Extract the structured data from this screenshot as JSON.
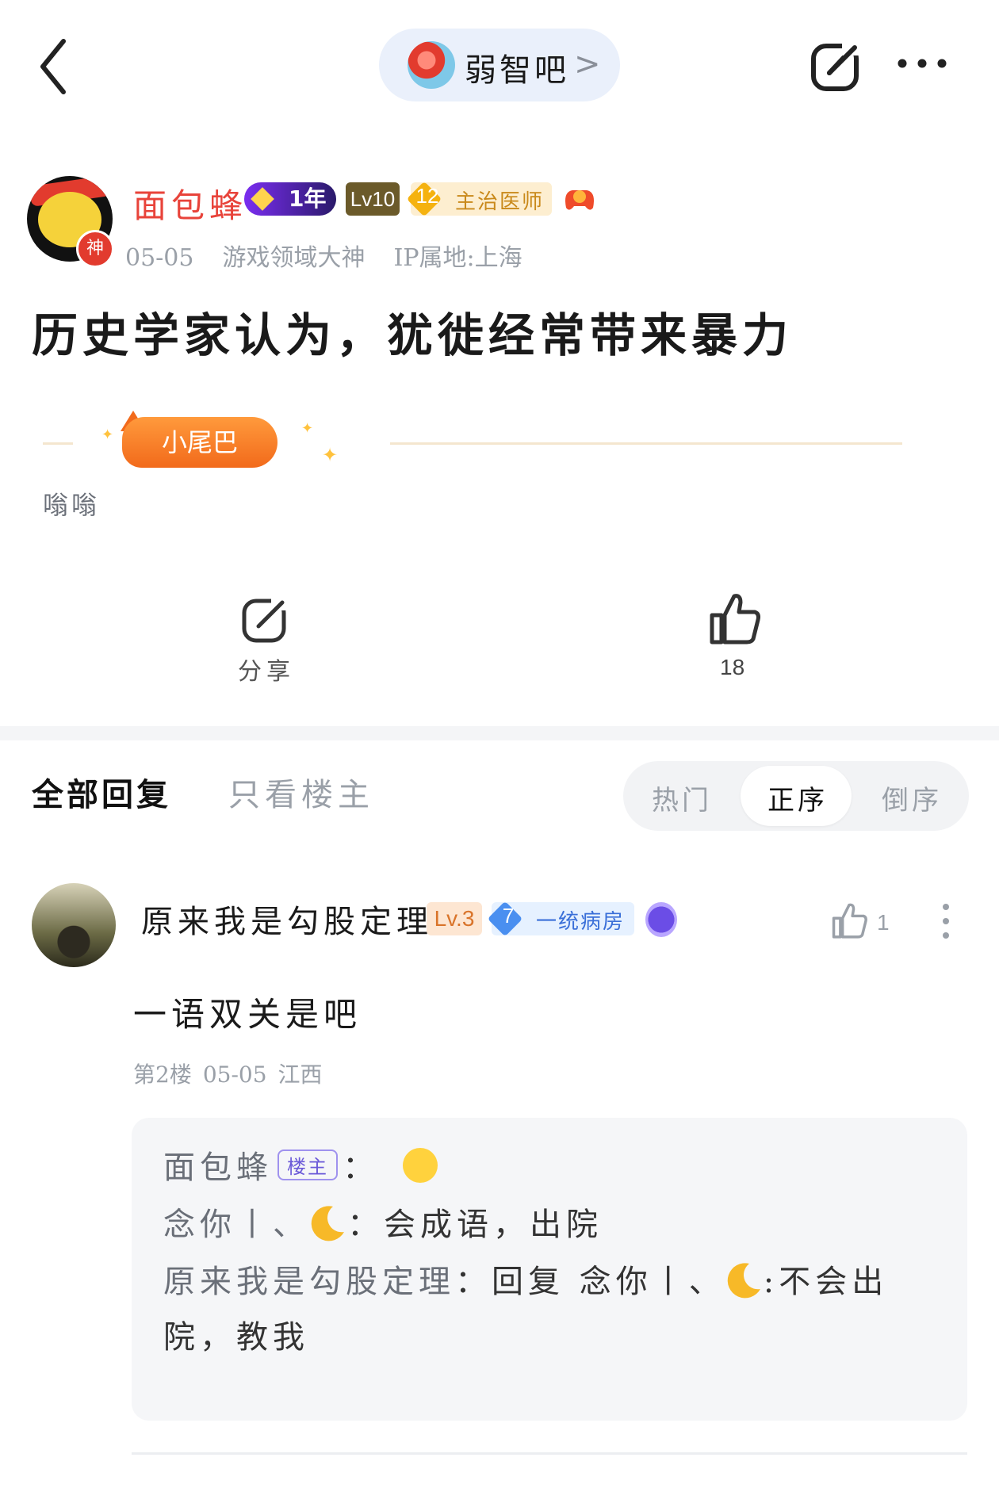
{
  "topbar": {
    "forum_name": "弱智吧",
    "forum_arrow": ">",
    "back_icon": "chevron-left-icon",
    "share_icon": "share-icon",
    "more_icon": "more-dots-icon"
  },
  "author": {
    "name": "面包蜂",
    "god_badge": "神",
    "year_badge": "1年",
    "level_badge": "Lv10",
    "doctor_level": "12",
    "doctor_title": "主治医师",
    "date": "05-05",
    "tag": "游戏领域大神",
    "ip": "IP属地:上海"
  },
  "post": {
    "title": "历史学家认为，犹徙经常带来暴力",
    "tail_label": "小尾巴",
    "signature": "嗡嗡"
  },
  "actions": {
    "share_label": "分享",
    "like_count": "18"
  },
  "tabs": {
    "all": "全部回复",
    "owner_only": "只看楼主",
    "sort_hot": "热门",
    "sort_asc": "正序",
    "sort_desc": "倒序"
  },
  "reply": {
    "name": "原来我是勾股定理",
    "level_badge": "Lv.3",
    "ward_level": "7",
    "ward_title": "一统病房",
    "like_count": "1",
    "content": "一语双关是吧",
    "floor": "第2楼",
    "date": "05-05",
    "location": "江西"
  },
  "sub_replies": {
    "line1_name": "面包蜂",
    "owner_tag": "楼主",
    "colon": "：",
    "line2_name": "念你丨、",
    "line2_text": "：会成语，出院",
    "line3_name": "原来我是勾股定理",
    "line3_text_a": "：回复 念你丨、",
    "line3_text_b": ":不会出",
    "line4_text": "院，教我"
  },
  "colors": {
    "accent_red": "#e8433a",
    "pill_bg": "#eaf0fb",
    "muted": "#9aa0a8"
  }
}
